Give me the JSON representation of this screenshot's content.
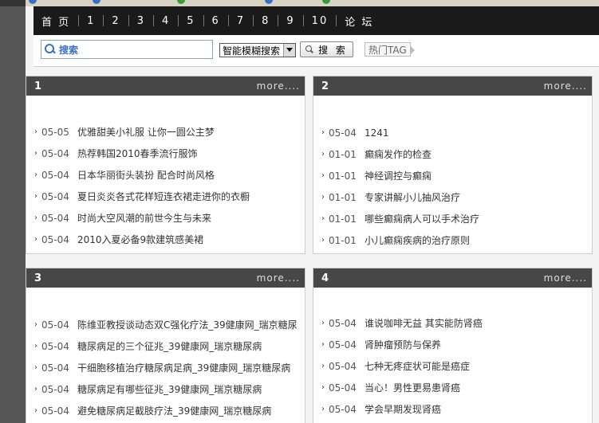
{
  "favorites": [
    {
      "icon": "ie-icon",
      "label": "..."
    },
    {
      "icon": "ie-icon",
      "label": "..."
    },
    {
      "icon": "green-globe-icon",
      "label": "..."
    },
    {
      "icon": "ie-icon",
      "label": "..."
    },
    {
      "icon": "folder-icon",
      "label": "..."
    }
  ],
  "nav": {
    "items": [
      "首 页",
      "1",
      "2",
      "3",
      "4",
      "5",
      "6",
      "7",
      "8",
      "9",
      "10",
      "论 坛"
    ]
  },
  "search": {
    "placeholder": "搜索",
    "mode_selected": "智能模糊搜索",
    "button_label": "搜 索",
    "hot_tag_label": "热门TAG"
  },
  "panels": [
    {
      "title": "1",
      "more": "more....",
      "items": [
        {
          "date": "05-05",
          "title": "优雅甜美小礼服 让你一圆公主梦"
        },
        {
          "date": "05-04",
          "title": "热荐韩国2010春季流行服饰"
        },
        {
          "date": "05-04",
          "title": "日本华丽街头装扮 配合时尚风格"
        },
        {
          "date": "05-04",
          "title": "夏日炎炎各式花样短连衣裙走进你的衣橱"
        },
        {
          "date": "05-04",
          "title": "时尚大空风潮的前世今生与未来"
        },
        {
          "date": "05-04",
          "title": "2010入夏必备9款建筑感美裙"
        }
      ]
    },
    {
      "title": "2",
      "more": "more....",
      "items": [
        {
          "date": "05-04",
          "title": "1241"
        },
        {
          "date": "01-01",
          "title": "癫痫发作的检查"
        },
        {
          "date": "01-01",
          "title": "神经调控与癫痫"
        },
        {
          "date": "01-01",
          "title": "专家讲解小儿抽风治疗"
        },
        {
          "date": "01-01",
          "title": "哪些癫痫病人可以手术治疗"
        },
        {
          "date": "01-01",
          "title": "小儿癫痫疾病的治疗原则"
        }
      ]
    },
    {
      "title": "3",
      "more": "more....",
      "items": [
        {
          "date": "05-04",
          "title": "陈维亚教授谈动态双C强化疗法_39健康网_瑞京糖尿"
        },
        {
          "date": "05-04",
          "title": "糖尿病足的三个征兆_39健康网_瑞京糖尿病"
        },
        {
          "date": "05-04",
          "title": "干细胞移植治疗糖尿病足病_39健康网_瑞京糖尿病"
        },
        {
          "date": "05-04",
          "title": "糖尿病足有哪些征兆_39健康网_瑞京糖尿病"
        },
        {
          "date": "05-04",
          "title": "避免糖尿病足截肢疗法_39健康网_瑞京糖尿病"
        }
      ]
    },
    {
      "title": "4",
      "more": "more....",
      "items": [
        {
          "date": "05-04",
          "title": "谁说咖啡无益 其实能防肾癌"
        },
        {
          "date": "05-04",
          "title": "肾肿瘤预防与保养"
        },
        {
          "date": "05-04",
          "title": "七种无疼症状可能是癌症"
        },
        {
          "date": "05-04",
          "title": "当心！男性更易患肾癌"
        },
        {
          "date": "05-04",
          "title": "学会早期发现肾癌"
        }
      ]
    }
  ]
}
